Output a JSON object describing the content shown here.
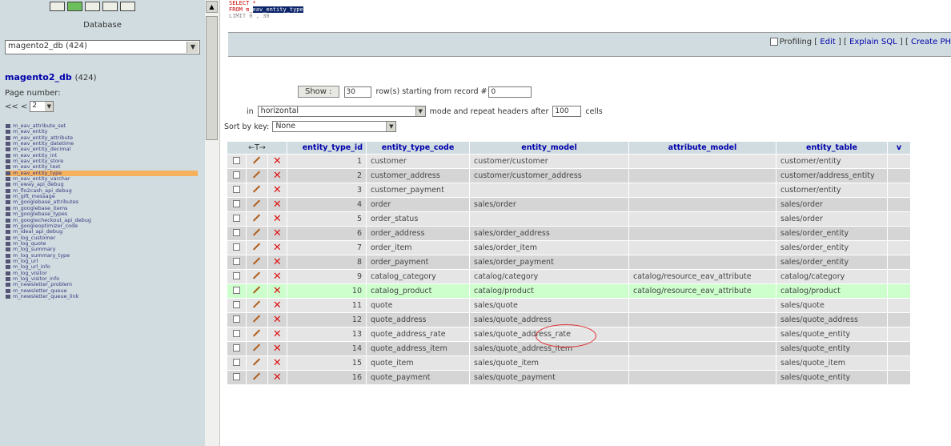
{
  "left": {
    "database_label": "Database",
    "database_select": "magento2_db (424)",
    "db_title": "magento2_db",
    "db_count": "(424)",
    "page_number_label": "Page number:",
    "page_nav_prev": "<< <",
    "page_select": "2",
    "tables": [
      "m_eav_attribute_set",
      "m_eav_entity",
      "m_eav_entity_attribute",
      "m_eav_entity_datetime",
      "m_eav_entity_decimal",
      "m_eav_entity_int",
      "m_eav_entity_store",
      "m_eav_entity_text",
      "m_eav_entity_type",
      "m_eav_entity_varchar",
      "m_eway_api_debug",
      "m_flo2cash_api_debug",
      "m_gift_message",
      "m_googlebase_attributes",
      "m_googlebase_items",
      "m_googlebase_types",
      "m_googlecheckout_api_debug",
      "m_googleoptimizer_code",
      "m_ideal_api_debug",
      "m_log_customer",
      "m_log_quote",
      "m_log_summary",
      "m_log_summary_type",
      "m_log_url",
      "m_log_url_info",
      "m_log_visitor",
      "m_log_visitor_info",
      "m_newsletter_problem",
      "m_newsletter_queue",
      "m_newsletter_queue_link"
    ]
  },
  "sql": {
    "line1": "SELECT *",
    "from_kw": "FROM",
    "from_prefix": "m_",
    "table": "eav_entity_type",
    "line3": "LIMIT 0 , 30"
  },
  "toolbar": {
    "profiling": "Profiling",
    "edit": "Edit",
    "explain": "Explain SQL",
    "create": "Create PH"
  },
  "controls": {
    "show_button": "Show :",
    "rows_value": "30",
    "rows_text": "row(s) starting from record #",
    "start_value": "0",
    "in_label": "in",
    "mode_select": "horizontal",
    "mode_text": "mode and repeat headers after",
    "headers_value": "100",
    "cells_label": "cells",
    "sort_label": "Sort by key:",
    "sort_select": "None"
  },
  "table": {
    "actions_header": "←T→",
    "headers": [
      "entity_type_id",
      "entity_type_code",
      "entity_model",
      "attribute_model",
      "entity_table",
      "v"
    ],
    "rows": [
      [
        "1",
        "customer",
        "customer/customer",
        "",
        "customer/entity"
      ],
      [
        "2",
        "customer_address",
        "customer/customer_address",
        "",
        "customer/address_entity"
      ],
      [
        "3",
        "customer_payment",
        "",
        "",
        "customer/entity"
      ],
      [
        "4",
        "order",
        "sales/order",
        "",
        "sales/order"
      ],
      [
        "5",
        "order_status",
        "",
        "",
        "sales/order"
      ],
      [
        "6",
        "order_address",
        "sales/order_address",
        "",
        "sales/order_entity"
      ],
      [
        "7",
        "order_item",
        "sales/order_item",
        "",
        "sales/order_entity"
      ],
      [
        "8",
        "order_payment",
        "sales/order_payment",
        "",
        "sales/order_entity"
      ],
      [
        "9",
        "catalog_category",
        "catalog/category",
        "catalog/resource_eav_attribute",
        "catalog/category"
      ],
      [
        "10",
        "catalog_product",
        "catalog/product",
        "catalog/resource_eav_attribute",
        "catalog/product"
      ],
      [
        "11",
        "quote",
        "sales/quote",
        "",
        "sales/quote"
      ],
      [
        "12",
        "quote_address",
        "sales/quote_address",
        "",
        "sales/quote_address"
      ],
      [
        "13",
        "quote_address_rate",
        "sales/quote_address_rate",
        "",
        "sales/quote_entity"
      ],
      [
        "14",
        "quote_address_item",
        "sales/quote_address_item",
        "",
        "sales/quote_entity"
      ],
      [
        "15",
        "quote_item",
        "sales/quote_item",
        "",
        "sales/quote_item"
      ],
      [
        "16",
        "quote_payment",
        "sales/quote_payment",
        "",
        "sales/quote_entity"
      ]
    ]
  },
  "colors": {
    "highlight_table": "#f6b15c",
    "selected_row": "#ccffcc",
    "delete_icon": "#dd1111",
    "header_text": "#0000aa"
  }
}
